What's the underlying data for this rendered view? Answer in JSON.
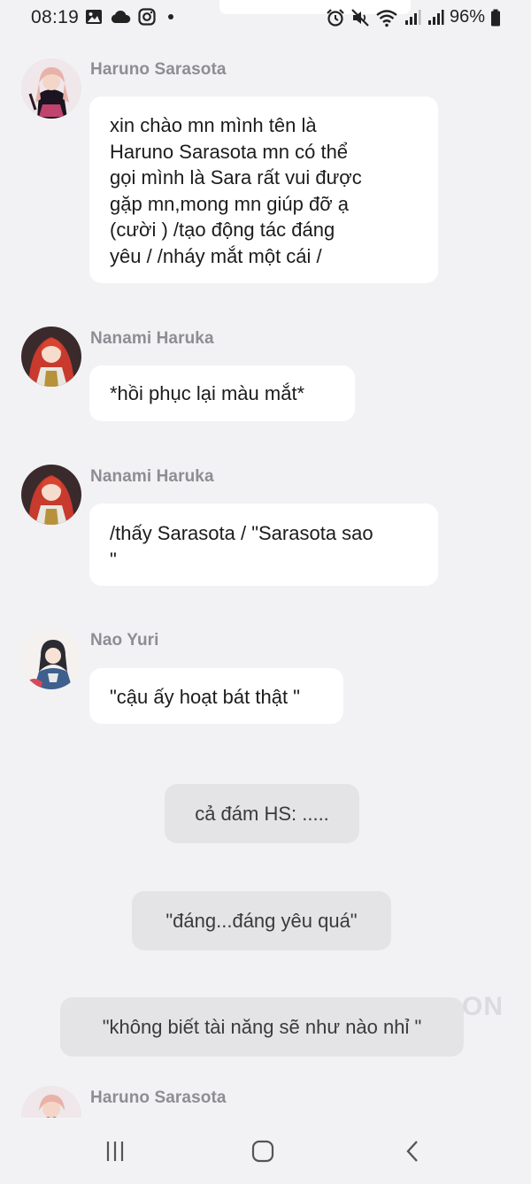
{
  "status_bar": {
    "time": "08:19",
    "battery": "96%",
    "left_icons": [
      "gallery-icon",
      "cloud-icon",
      "instagram-icon",
      "dot-icon"
    ],
    "right_icons": [
      "alarm-icon",
      "mute-icon",
      "wifi-icon",
      "signal-icon",
      "signal-icon",
      "battery-icon"
    ]
  },
  "messages": [
    {
      "type": "character",
      "name": "Haruno Sarasota",
      "text": "xin chào mn mình tên là\nHaruno Sarasota mn có thể\ngọi mình là Sara rất vui được\ngặp mn,mong mn giúp đỡ ạ\n(cười ) /tạo động tác đáng\nyêu / /nháy mắt một cái /"
    },
    {
      "type": "character",
      "name": "Nanami Haruka",
      "text": "*hồi phục lại màu mắt*"
    },
    {
      "type": "character",
      "name": "Nanami Haruka",
      "text": "/thấy Sarasota / \"Sarasota sao\n\""
    },
    {
      "type": "character",
      "name": "Nao Yuri",
      "text": "\"cậu ấy hoạt bát thật \""
    },
    {
      "type": "narration",
      "text": "cả đám HS: ....."
    },
    {
      "type": "narration",
      "text": "\"đáng...đáng yêu quá\""
    },
    {
      "type": "narration",
      "text": "\"không biết tài năng sẽ như nào nhỉ \""
    },
    {
      "type": "character",
      "name": "Haruno Sarasota",
      "text": ""
    }
  ],
  "watermark": "ON",
  "nav_bar": {
    "buttons": [
      "recent-apps-icon",
      "home-icon",
      "back-icon"
    ]
  },
  "colors": {
    "background": "#f2f2f4",
    "bubble": "#ffffff",
    "narration_bubble": "#e4e4e6",
    "name_text": "#8d8d93"
  }
}
